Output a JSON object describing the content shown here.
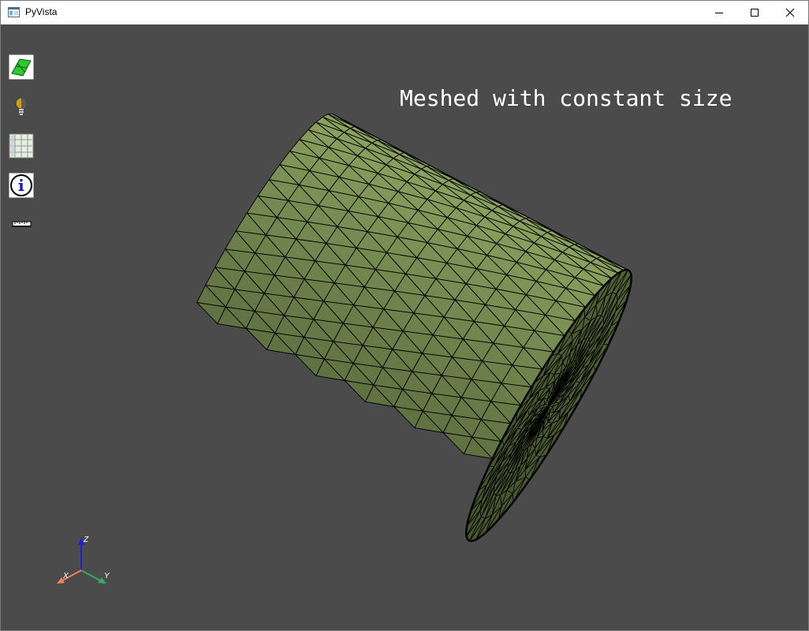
{
  "window": {
    "title": "PyVista"
  },
  "viewport": {
    "background": "#4b4b4b",
    "overlay_text": "Meshed with constant size",
    "mesh_color": "#8aa362",
    "mesh_shadow_color": "#4a5733",
    "edge_color": "#000000"
  },
  "toolbar": {
    "items": [
      {
        "name": "mesh-visibility-icon"
      },
      {
        "name": "light-bulb-icon"
      },
      {
        "name": "grid-icon"
      },
      {
        "name": "info-icon"
      },
      {
        "name": "ruler-icon"
      }
    ]
  },
  "axes": {
    "x_label": "X",
    "y_label": "Y",
    "z_label": "Z",
    "x_color": "#f0805a",
    "y_color": "#3aa56e",
    "z_color": "#1f1fd8"
  }
}
